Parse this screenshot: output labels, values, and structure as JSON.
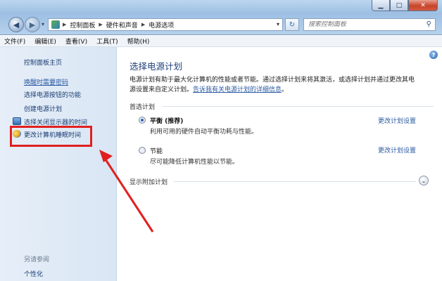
{
  "window": {
    "minimize": "▁",
    "maximize": "□",
    "close": "✕"
  },
  "address": {
    "breadcrumbs": [
      "控制面板",
      "硬件和声音",
      "电源选项"
    ],
    "search_placeholder": "搜索控制面板"
  },
  "menu": [
    "文件(F)",
    "编辑(E)",
    "查看(V)",
    "工具(T)",
    "帮助(H)"
  ],
  "sidebar": {
    "home": "控制面板主页",
    "items": [
      "唤醒时需要密码",
      "选择电源按钮的功能",
      "创建电源计划",
      "选择关闭显示器的时间",
      "更改计算机睡眠时间"
    ],
    "see_also": "另请参阅",
    "personalize": "个性化"
  },
  "main": {
    "title": "选择电源计划",
    "desc_line1": "电源计划有助于最大化计算机的性能或者节能。通过选择计划来将其激活，或选择计划并通过更改其电",
    "desc_line2": "源设置来自定义计划。",
    "desc_link": "告诉我有关电源计划的详细信息",
    "desc_end": "。",
    "preferred_label": "首选计划",
    "plans": [
      {
        "name": "平衡 (推荐)",
        "desc": "利用可用的硬件自动平衡功耗与性能。",
        "link": "更改计划设置",
        "selected": true
      },
      {
        "name": "节能",
        "desc": "尽可能降低计算机性能以节能。",
        "link": "更改计划设置",
        "selected": false
      }
    ],
    "extra_label": "显示附加计划"
  },
  "annotation_color": "#e0201f"
}
